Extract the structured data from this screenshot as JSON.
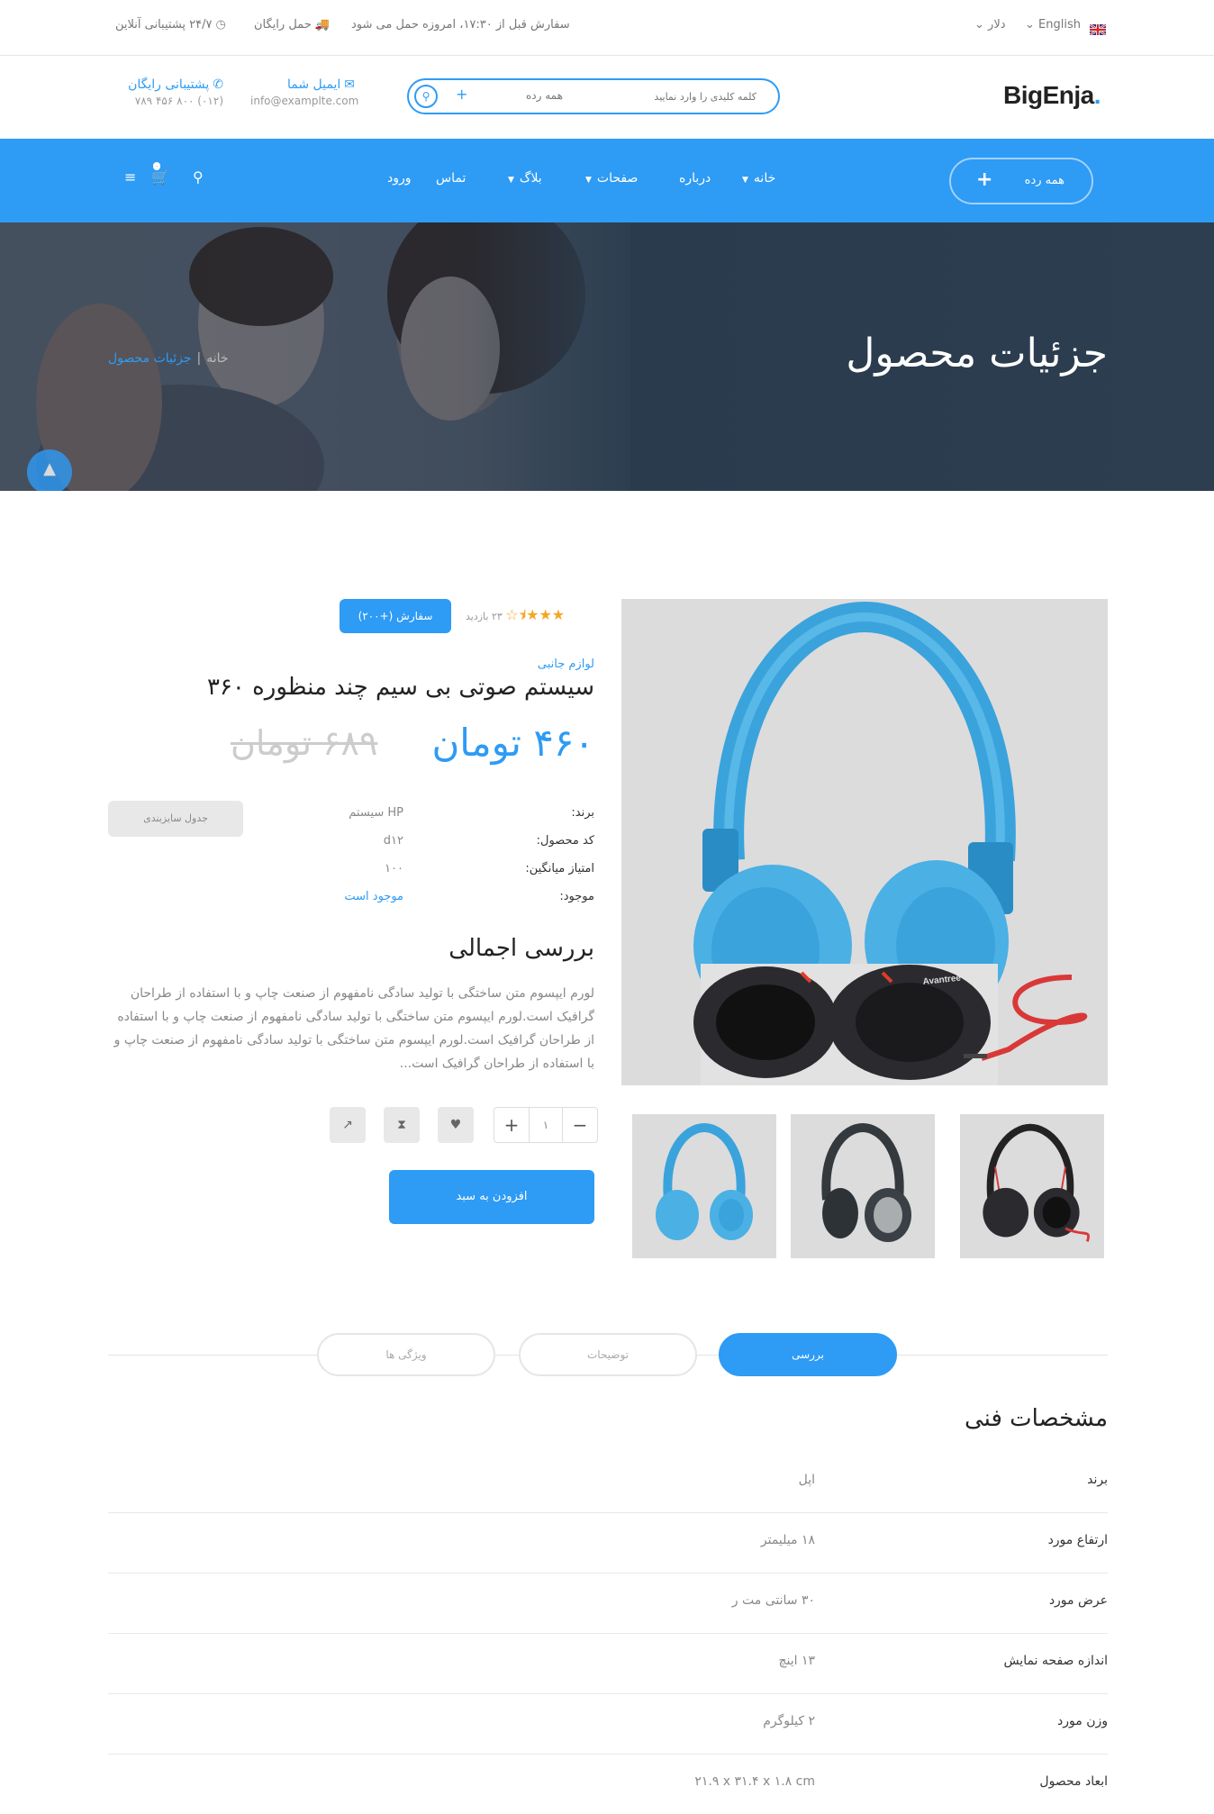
{
  "topbar": {
    "flag_icon": "uk-flag-icon",
    "language": "English",
    "currency": "دلار",
    "order_notice": "سفارش قبل از ۱۷:۳۰، امروزه حمل می شود",
    "free_shipping": "حمل رایگان",
    "support": "۲۴/۷ پشتیبانی آنلاین"
  },
  "header": {
    "logo": "BigEnja",
    "logo_dot": ".",
    "search": {
      "placeholder": "کلمه کلیدی را وارد نمایید",
      "category": "همه رده",
      "plus": "+"
    },
    "email": {
      "title": "ایمیل شما",
      "value": "info@examplte.com"
    },
    "phone": {
      "title": "پشتیبانی رایگان",
      "value": "(۰۱۲) ۸۰۰ ۴۵۶ ۷۸۹"
    }
  },
  "nav": {
    "category_button": "همه رده",
    "category_plus": "+",
    "items": [
      "خانه",
      "درباره",
      "صفحات",
      "بلاگ",
      "تماس",
      "ورود"
    ],
    "cart_count": "۰"
  },
  "hero": {
    "title": "جزئیات محصول",
    "breadcrumb_home": "خانه",
    "breadcrumb_sep": "|",
    "breadcrumb_current": "جزئیات محصول"
  },
  "product": {
    "rating_stars": 3.5,
    "views": "۲۳ بازدید",
    "order_badge": "سفارش (+۲۰۰)",
    "category": "لوازم جانبی",
    "title": "سیستم صوتی بی سیم چند منظوره ۳۶۰",
    "price_new": "۴۶۰ تومان",
    "price_old": "۶۸۹ تومان",
    "specs": [
      {
        "label": "برند:",
        "value": "HP سیستم"
      },
      {
        "label": "کد محصول:",
        "value": "d۱۲"
      },
      {
        "label": "امتیاز میانگین:",
        "value": "۱۰۰"
      },
      {
        "label": "موجود:",
        "value": "موجود است"
      }
    ],
    "size_chart": "جدول سایزبندی",
    "overview_title": "بررسی اجمالی",
    "overview_text": "لورم ایپسوم متن ساختگی با تولید سادگی نامفهوم از صنعت چاپ و با استفاده از طراحان گرافیک است.لورم ایپسوم متن ساختگی با تولید سادگی نامفهوم از صنعت چاپ و با استفاده از طراحان گرافیک است.لورم ایپسوم متن ساختگی با تولید سادگی نامفهوم از صنعت چاپ و با استفاده از طراحان گرافیک است...",
    "quantity": "۱",
    "add_to_cart": "افزودن به سبد",
    "image_brand": "Avantree"
  },
  "tabs": [
    "بررسی",
    "توضیحات",
    "ویژگی ها"
  ],
  "tech_specs": {
    "title": "مشخصات فنی",
    "rows": [
      {
        "key": "برند",
        "value": "اپل"
      },
      {
        "key": "ارتفاع مورد",
        "value": "۱۸ میلیمتر"
      },
      {
        "key": "عرض مورد",
        "value": "۳۰ سانتی مت ر"
      },
      {
        "key": "اندازه صفحه نمایش",
        "value": "۱۳ اینچ"
      },
      {
        "key": "وزن مورد",
        "value": "۲ کیلوگرم"
      },
      {
        "key": "ابعاد محصول",
        "value": "۲۱.۹ x ۳۱.۴ x ۱.۸ cm"
      }
    ]
  },
  "colors": {
    "accent": "#2e9bf5",
    "hero_bg": "#2c3e50",
    "headphone_blue": "#3aa3dc"
  }
}
